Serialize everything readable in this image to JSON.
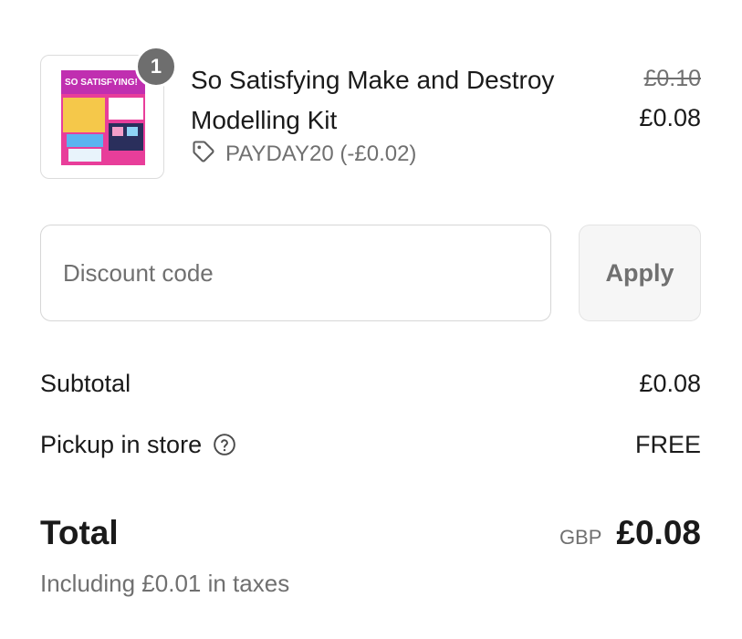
{
  "product": {
    "quantity": "1",
    "title": "So Satisfying Make and Destroy Modelling Kit",
    "image_text": "SO SATISFYING!",
    "discount_code": "PAYDAY20 (-£0.02)",
    "original_price": "£0.10",
    "price": "£0.08"
  },
  "discount": {
    "placeholder": "Discount code",
    "value": "",
    "apply_label": "Apply"
  },
  "summary": {
    "subtotal_label": "Subtotal",
    "subtotal_value": "£0.08",
    "shipping_label": "Pickup in store",
    "shipping_value": "FREE",
    "total_label": "Total",
    "currency": "GBP",
    "total_value": "£0.08",
    "taxes_note": "Including £0.01 in taxes"
  },
  "icons": {
    "discount": "tag-icon",
    "shipping_help": "question-circle-icon"
  }
}
